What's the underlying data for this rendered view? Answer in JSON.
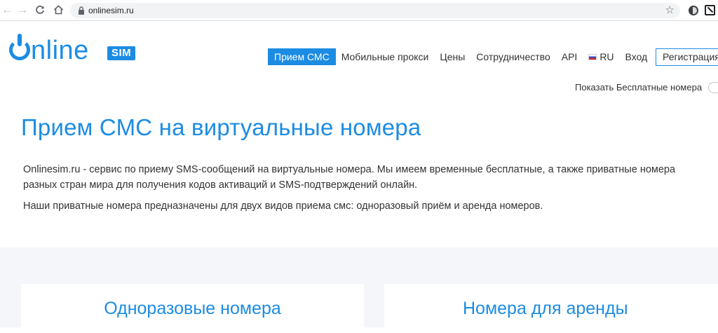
{
  "browser": {
    "url": "onlinesim.ru",
    "back_icon": "←",
    "forward_icon": "→",
    "star_icon": "☆"
  },
  "logo": {
    "word": "nline",
    "badge": "SIM"
  },
  "nav": {
    "items": [
      {
        "label": "Прием СМС",
        "active": true
      },
      {
        "label": "Мобильные прокси"
      },
      {
        "label": "Цены"
      },
      {
        "label": "Сотрудничество"
      },
      {
        "label": "API"
      }
    ],
    "lang": "RU",
    "login": "Вход",
    "register": "Регистрация"
  },
  "free_toggle": {
    "label": "Показать Бесплатные номера"
  },
  "hero": {
    "title": "Прием СМС на виртуальные номера",
    "description": "Onlinesim.ru - сервис по приему SMS-сообщений на виртуальные номера. Мы имеем временные бесплатные, а также приватные номера разных стран мира для получения кодов активаций и SMS-подтверждений онлайн.",
    "description2": "Наши приватные номера предназначены для двух видов приема смс: одноразовый приём и аренда номеров."
  },
  "cards": {
    "left_title": "Одноразовые номера",
    "right_title": "Номера для аренды"
  },
  "colors": {
    "accent": "#1c8ce3",
    "text": "#333333",
    "section_bg": "#f4f6f9"
  }
}
